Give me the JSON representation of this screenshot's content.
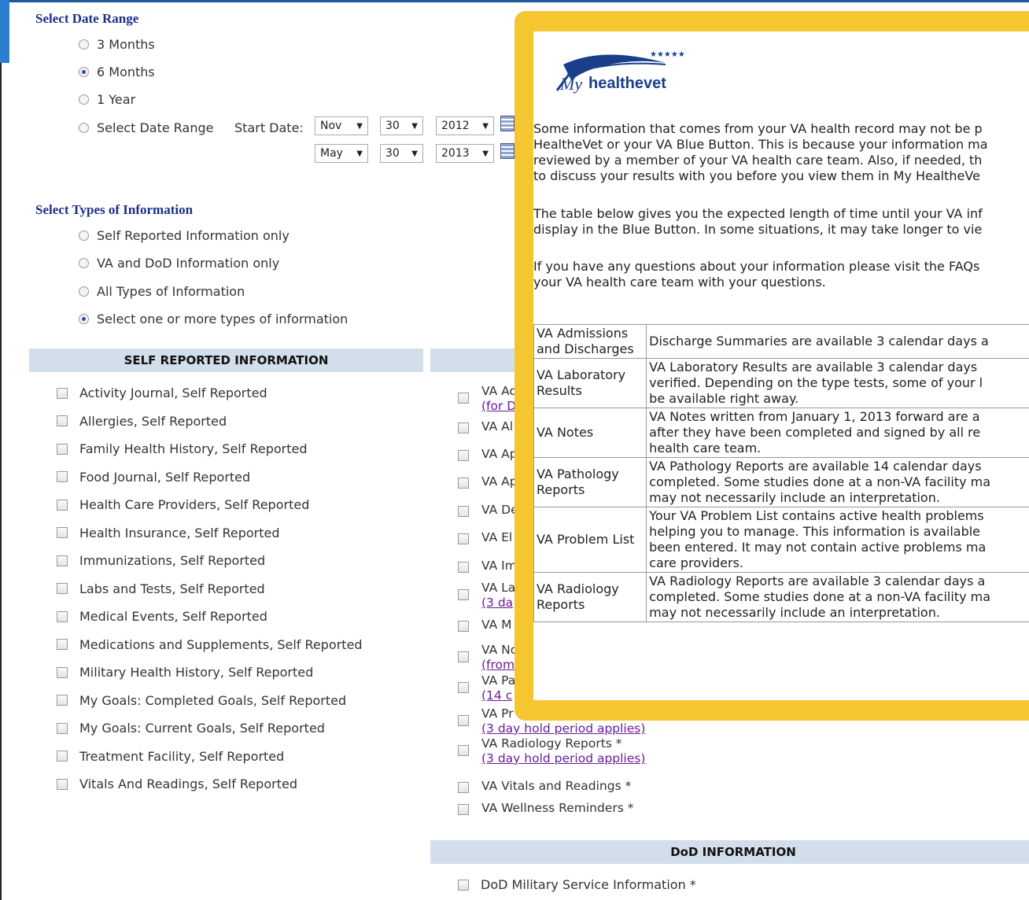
{
  "date_range": {
    "title": "Select Date Range",
    "options": [
      "3 Months",
      "6 Months",
      "1 Year",
      "Select Date Range"
    ],
    "selected": "6 Months",
    "start_label": "Start Date:",
    "start": {
      "month": "Nov",
      "day": "30",
      "year": "2012"
    },
    "end": {
      "month": "May",
      "day": "30",
      "year": "2013"
    }
  },
  "types": {
    "title": "Select Types of Information",
    "options": [
      "Self Reported Information only",
      "VA and DoD Information only",
      "All Types of Information",
      "Select one or more types of information"
    ],
    "selected": "Select one or more types of information"
  },
  "self_reported": {
    "header": "SELF REPORTED INFORMATION",
    "items": [
      "Activity Journal, Self Reported",
      "Allergies, Self Reported",
      "Family Health History, Self Reported",
      "Food Journal, Self Reported",
      "Health Care Providers, Self Reported",
      "Health Insurance, Self Reported",
      "Immunizations, Self Reported",
      "Labs and Tests, Self Reported",
      "Medical Events, Self Reported",
      "Medications and Supplements, Self Reported",
      "Military Health History, Self Reported",
      "My Goals: Completed Goals, Self Reported",
      "My Goals: Current Goals, Self Reported",
      "Treatment Facility, Self Reported",
      "Vitals And Readings, Self Reported"
    ]
  },
  "va": {
    "items": [
      {
        "label": "VA Ad",
        "link": "(for D"
      },
      {
        "label": "VA Al",
        "link": ""
      },
      {
        "label": "VA Ap",
        "link": ""
      },
      {
        "label": "VA Ap",
        "link": ""
      },
      {
        "label": "VA De",
        "link": ""
      },
      {
        "label": "VA El",
        "link": ""
      },
      {
        "label": "VA Im",
        "link": ""
      },
      {
        "label": "VA La",
        "link": "(3 da"
      },
      {
        "label": "VA M",
        "link": ""
      },
      {
        "label": "VA No",
        "link": "(from"
      },
      {
        "label": "VA Pa",
        "link": "(14 c"
      },
      {
        "label": "VA Pr",
        "link": "(3 day hold period applies)"
      },
      {
        "label": "VA Radiology Reports *",
        "link": "(3 day hold period applies)"
      },
      {
        "label": "VA Vitals and Readings *",
        "link": ""
      },
      {
        "label": "VA Wellness Reminders *",
        "link": ""
      }
    ]
  },
  "dod": {
    "header": "DoD INFORMATION",
    "items": [
      "DoD Military Service Information *"
    ]
  },
  "modal": {
    "logo_text": "My healthevet",
    "para1": [
      "Some information that comes from your VA health record may not be p",
      "HealtheVet or your VA Blue Button. This is because your information ma",
      "reviewed by a member of your VA health care team. Also, if needed, th",
      "to discuss your results with you before you view them in My HealtheVe"
    ],
    "para2": [
      "The table below gives you the expected length of time until your VA inf",
      "display in the Blue Button. In some situations, it may take longer to vie"
    ],
    "para3": [
      "If you have any questions about your information please visit the FAQs",
      "your VA health care team with your questions."
    ],
    "table": [
      {
        "label": [
          "VA Admissions",
          "and Discharges"
        ],
        "desc": [
          "Discharge Summaries are available 3 calendar days a"
        ]
      },
      {
        "label": [
          "VA Laboratory",
          "Results"
        ],
        "desc": [
          "VA Laboratory Results are available 3 calendar days",
          "verified. Depending on the type tests, some of your l",
          "be available right away."
        ]
      },
      {
        "label": [
          "VA Notes"
        ],
        "desc": [
          "VA Notes written from January 1, 2013 forward are a",
          "after they have been completed and signed by all re",
          "health care team."
        ]
      },
      {
        "label": [
          "VA Pathology",
          "Reports"
        ],
        "desc": [
          "VA Pathology Reports are available 14 calendar days",
          "completed. Some studies done at a non-VA facility ma",
          "may not necessarily include an interpretation."
        ]
      },
      {
        "label": [
          "VA Problem List"
        ],
        "desc": [
          "Your VA Problem List contains active health problems",
          "helping you to manage. This information is available",
          "been entered. It may not contain active problems ma",
          "care providers."
        ]
      },
      {
        "label": [
          "VA Radiology",
          "Reports"
        ],
        "desc": [
          "VA Radiology Reports are available 3 calendar days a",
          "completed. Some studies done at a non-VA facility ma",
          "may not necessarily include an interpretation."
        ]
      }
    ]
  },
  "colors": {
    "accent": "#f6c631",
    "title": "#1b2f8a",
    "header_bar": "#d2deea",
    "link": "#6a1b9a"
  }
}
